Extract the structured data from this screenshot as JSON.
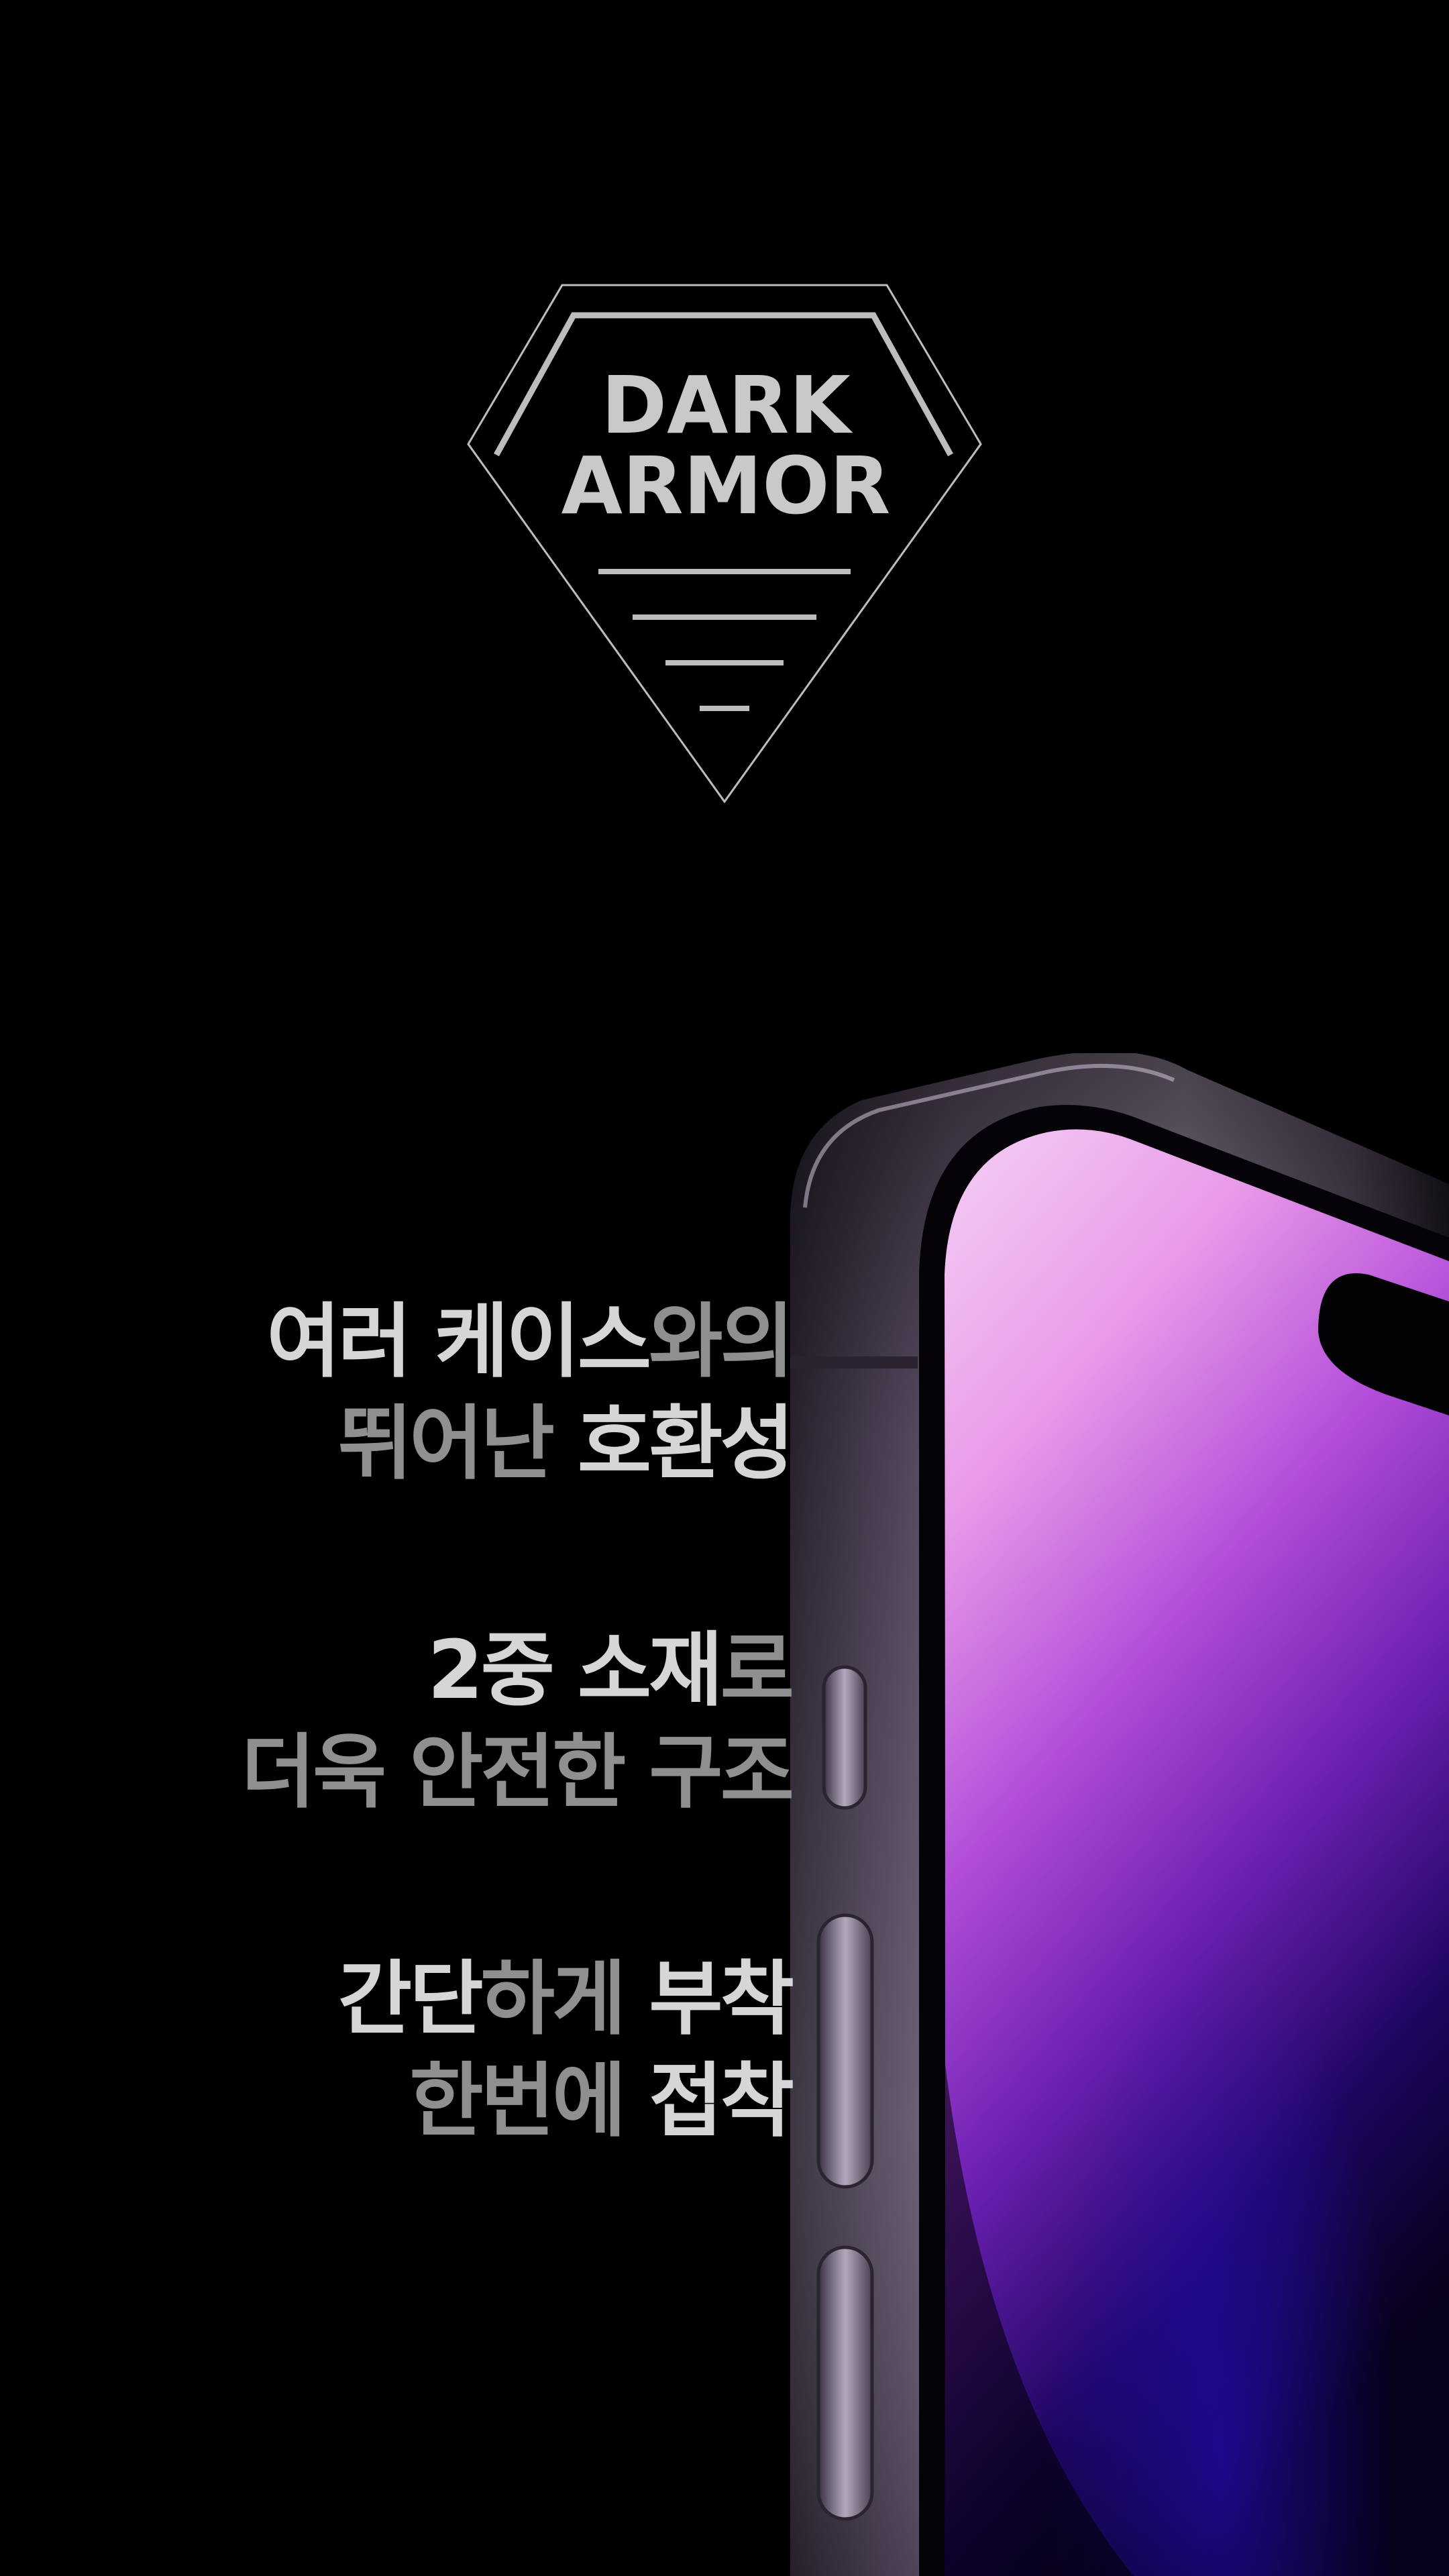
{
  "logo": {
    "line1": "DARK",
    "line2": "ARMOR"
  },
  "features": [
    {
      "line1": [
        {
          "text": "여러 케이스",
          "tone": "hl"
        },
        {
          "text": "와의",
          "tone": "dim"
        }
      ],
      "line2": [
        {
          "text": "뛰어난 ",
          "tone": "dim"
        },
        {
          "text": "호환성",
          "tone": "hl"
        }
      ]
    },
    {
      "line1": [
        {
          "text": "2중 소재",
          "tone": "hl"
        },
        {
          "text": "로",
          "tone": "dim"
        }
      ],
      "line2": [
        {
          "text": "더욱 안전한 구조",
          "tone": "dim"
        }
      ]
    },
    {
      "line1": [
        {
          "text": "간단",
          "tone": "hl"
        },
        {
          "text": "하게 ",
          "tone": "dim"
        },
        {
          "text": "부착",
          "tone": "hl"
        }
      ],
      "line2": [
        {
          "text": "한번에 ",
          "tone": "dim"
        },
        {
          "text": "접착",
          "tone": "hl"
        }
      ]
    }
  ],
  "colors": {
    "background": "#000000",
    "highlight_text": "#d6d6d6",
    "dim_text": "#8f8f8f",
    "logo_stroke": "#c9c9c9",
    "screen_top": "#f0bff2",
    "screen_mid": "#a13ad6",
    "screen_bottom": "#090018"
  }
}
